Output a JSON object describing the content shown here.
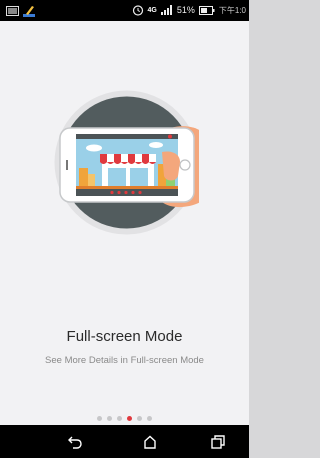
{
  "status_bar": {
    "signal_type": "4G",
    "battery_percent": "51%",
    "time": "下午1:0"
  },
  "onboarding": {
    "title": "Full-screen Mode",
    "subtitle": "See More Details in Full-screen Mode",
    "page_index": 3,
    "page_count": 6
  },
  "colors": {
    "accent": "#e0393e",
    "circle": "#525c5e",
    "hand": "#f4a77c",
    "sky": "#9ad0e8"
  },
  "icons": {
    "status_left": [
      "image-icon",
      "paint-icon"
    ],
    "status_right": [
      "alarm-icon",
      "signal-icon",
      "battery-icon"
    ],
    "nav": [
      "back-icon",
      "home-icon",
      "recent-apps-icon"
    ]
  }
}
